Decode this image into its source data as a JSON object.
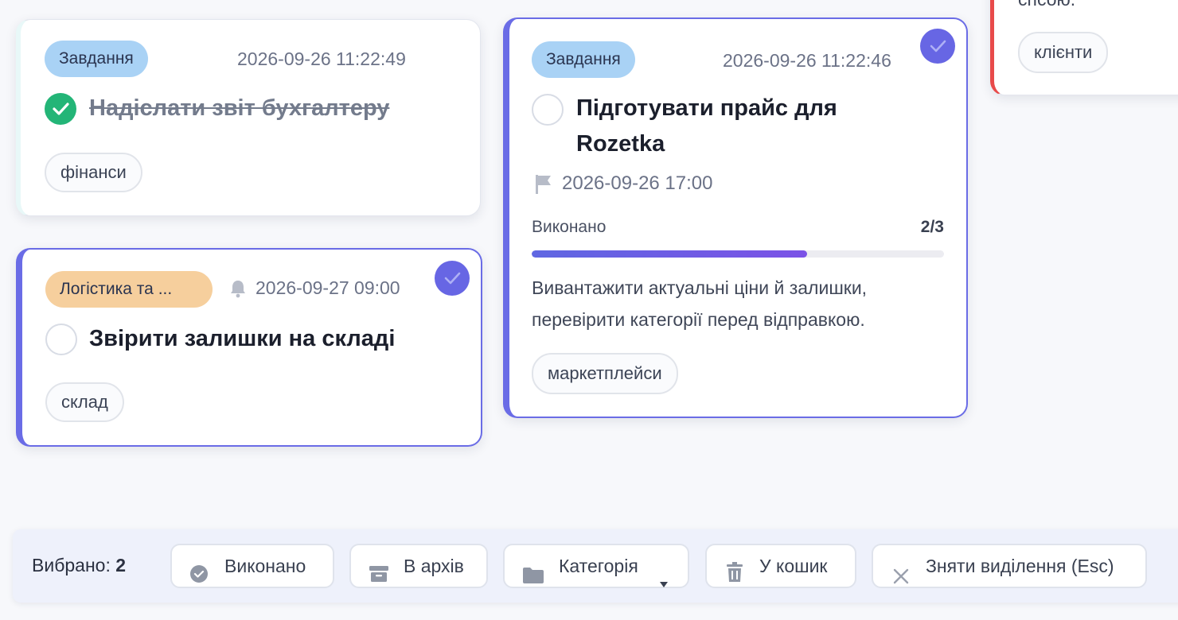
{
  "colors": {
    "accent": "#6766e4",
    "done_green": "#23b577",
    "tag_blue": "#a9d2f5",
    "tag_orange": "#f6cf9d",
    "danger_edge": "#e84a4a"
  },
  "cards": {
    "top_left": {
      "category": "Завдання",
      "timestamp": "2026-09-26 11:22:49",
      "title": "Надіслати звіт бухгалтеру",
      "completed": true,
      "label": "фінанси"
    },
    "bottom_left": {
      "category": "Логістика та ...",
      "reminder": "2026-09-27 09:00",
      "title": "Звірити залишки на складі",
      "selected": true,
      "label": "склад"
    },
    "center": {
      "category": "Завдання",
      "timestamp": "2026-09-26 11:22:46",
      "title_line1": "Підготувати прайс для",
      "title_line2": "Rozetka",
      "deadline": "2026-09-26 17:00",
      "progress_label": "Виконано",
      "progress_text": "2/3",
      "progress_fraction": 0.667,
      "description_line1": "Вивантажити актуальні ціни й залишки,",
      "description_line2": "перевірити категорії перед відправкою.",
      "selected": true,
      "label": "маркетплейси"
    },
    "top_right": {
      "text_fragment": "спсою.",
      "label": "клієнти"
    }
  },
  "selection_bar": {
    "selected_label": "Вибрано:",
    "selected_count": "2",
    "done_button": "Виконано",
    "archive_button": "В архів",
    "category_button": "Категорія",
    "trash_button": "У кошик",
    "clear_button": "Зняти виділення (Esc)",
    "icons": [
      "check-circle-icon",
      "archive-box-icon",
      "folder-icon",
      "caret-down-icon",
      "trash-icon",
      "close-icon"
    ]
  }
}
